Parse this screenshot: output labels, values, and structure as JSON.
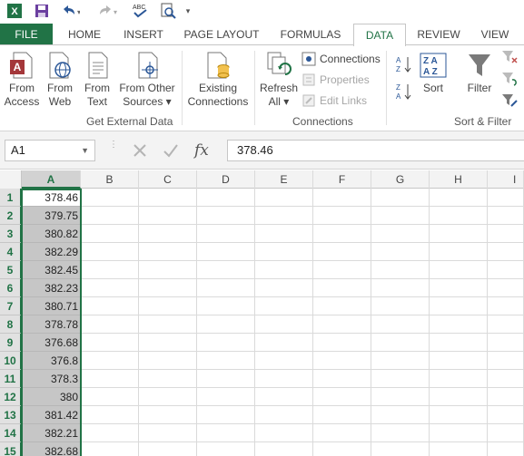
{
  "qat": {
    "icons": [
      "excel-logo-icon",
      "save-icon",
      "undo-icon",
      "redo-icon",
      "spelling-icon",
      "print-preview-icon",
      "customize-qat-icon"
    ]
  },
  "tabs": {
    "file": "FILE",
    "home": "HOME",
    "insert": "INSERT",
    "page_layout": "PAGE LAYOUT",
    "formulas": "FORMULAS",
    "data": "DATA",
    "review": "REVIEW",
    "view": "VIEW"
  },
  "ribbon": {
    "get_external": {
      "label": "Get External Data",
      "from_access": [
        "From",
        "Access"
      ],
      "from_web": [
        "From",
        "Web"
      ],
      "from_text": [
        "From",
        "Text"
      ],
      "from_other": [
        "From Other",
        "Sources ▾"
      ]
    },
    "existing": [
      "Existing",
      "Connections"
    ],
    "connections": {
      "label": "Connections",
      "refresh": [
        "Refresh",
        "All ▾"
      ],
      "connections_btn": "Connections",
      "properties": "Properties",
      "edit_links": "Edit Links"
    },
    "sort_filter": {
      "label": "Sort & Filter",
      "sort": "Sort",
      "filter": "Filter"
    }
  },
  "formula_bar": {
    "name_box": "A1",
    "fx": "fx",
    "value": "378.46"
  },
  "grid": {
    "columns": [
      "A",
      "B",
      "C",
      "D",
      "E",
      "F",
      "G",
      "H",
      "I"
    ],
    "selected_column": "A",
    "rows": [
      {
        "n": "1",
        "a": "378.46"
      },
      {
        "n": "2",
        "a": "379.75"
      },
      {
        "n": "3",
        "a": "380.82"
      },
      {
        "n": "4",
        "a": "382.29"
      },
      {
        "n": "5",
        "a": "382.45"
      },
      {
        "n": "6",
        "a": "382.23"
      },
      {
        "n": "7",
        "a": "380.71"
      },
      {
        "n": "8",
        "a": "378.78"
      },
      {
        "n": "9",
        "a": "376.68"
      },
      {
        "n": "10",
        "a": "376.8"
      },
      {
        "n": "11",
        "a": "378.3"
      },
      {
        "n": "12",
        "a": "380"
      },
      {
        "n": "13",
        "a": "381.42"
      },
      {
        "n": "14",
        "a": "382.21"
      },
      {
        "n": "15",
        "a": "382.68"
      }
    ]
  },
  "colors": {
    "accent": "#217346",
    "selection": "#c6c6c6"
  }
}
